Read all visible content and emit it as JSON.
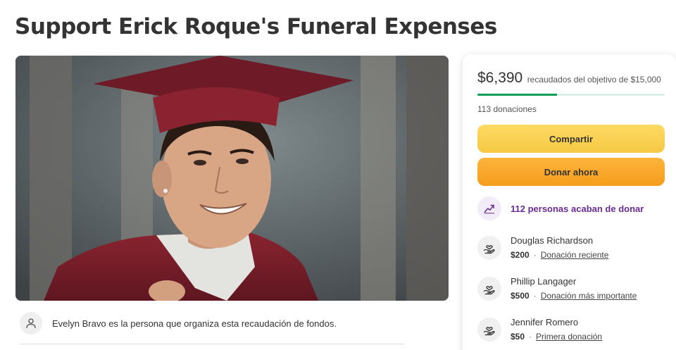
{
  "page": {
    "title": "Support Erick Roque's Funeral Expenses"
  },
  "organizer": {
    "text": "Evelyn Bravo es la persona que organiza esta recaudación de fondos.",
    "icon": "person-icon"
  },
  "fundraiser": {
    "raised": "$6,390",
    "goal_text": "recaudados del objetivo de $15,000",
    "progress_fraction": 0.426,
    "donations_count": "113 donaciones",
    "share_label": "Compartir",
    "donate_label": "Donar ahora",
    "recent_donors_text": "112 personas acaban de donar",
    "colors": {
      "progress": "#0e9e57",
      "share_button": "#f6c845",
      "donate_button": "#f59d1c",
      "recent_text": "#6a2c91"
    }
  },
  "donors": [
    {
      "name": "Douglas Richardson",
      "amount": "$200",
      "tag": "Donación reciente"
    },
    {
      "name": "Phillip Langager",
      "amount": "$500",
      "tag": "Donación más importante"
    },
    {
      "name": "Jennifer Romero",
      "amount": "$50",
      "tag": "Primera donación"
    }
  ]
}
